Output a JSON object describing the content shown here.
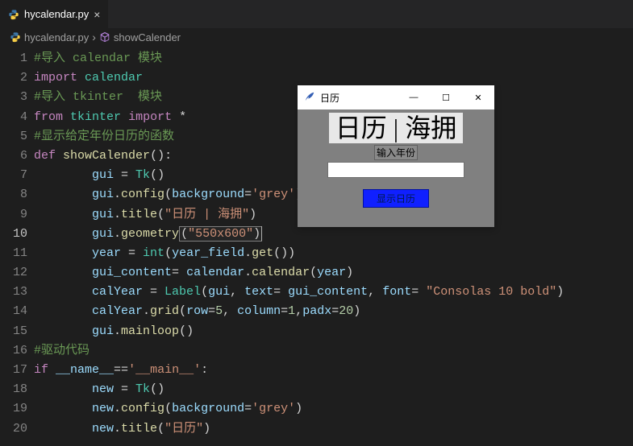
{
  "tab": {
    "filename": "hycalendar.py"
  },
  "breadcrumb": {
    "file": "hycalendar.py",
    "symbol": "showCalender"
  },
  "lines": [
    {
      "n": 1,
      "kind": "comment",
      "text": "#导入 calendar 模块"
    },
    {
      "n": 2,
      "kind": "import",
      "kw": "import",
      "mod": "calendar"
    },
    {
      "n": 3,
      "kind": "comment",
      "text": "#导入 tkinter  模块"
    },
    {
      "n": 4,
      "kind": "from",
      "kw1": "from",
      "mod": "tkinter",
      "kw2": "import",
      "star": "*"
    },
    {
      "n": 5,
      "kind": "comment",
      "text": "#显示给定年份日历的函数"
    },
    {
      "n": 6,
      "kind": "def",
      "kw": "def",
      "name": "showCalender",
      "sig": "():"
    },
    {
      "n": 7,
      "kind": "assign",
      "indent": 2,
      "lhs": "gui",
      "rhs_call": "Tk",
      "rhs_args": ""
    },
    {
      "n": 8,
      "kind": "call",
      "indent": 2,
      "obj": "gui",
      "method": "config",
      "args_kv": [
        [
          "background",
          "'grey'"
        ]
      ]
    },
    {
      "n": 9,
      "kind": "call",
      "indent": 2,
      "obj": "gui",
      "method": "title",
      "args_str": "\"日历 | 海拥\""
    },
    {
      "n": 10,
      "kind": "call",
      "indent": 2,
      "obj": "gui",
      "method": "geometry",
      "args_str": "\"550x600\"",
      "highlight": true,
      "current": true
    },
    {
      "n": 11,
      "kind": "assign",
      "indent": 2,
      "lhs": "year",
      "rhs_raw": "int(year_field.get())"
    },
    {
      "n": 12,
      "kind": "assign2",
      "indent": 2,
      "lhs": "gui_content",
      "rhs_obj": "calendar",
      "rhs_method": "calendar",
      "rhs_args_var": "year"
    },
    {
      "n": 13,
      "kind": "assign3",
      "indent": 2,
      "lhs": "calYear",
      "rhs": "Label(gui, text= gui_content, font= \"Consolas 10 bold\")"
    },
    {
      "n": 14,
      "kind": "call2",
      "indent": 2,
      "obj": "calYear",
      "method": "grid",
      "args": "row=5, column=1,padx=20"
    },
    {
      "n": 15,
      "kind": "call",
      "indent": 2,
      "obj": "gui",
      "method": "mainloop",
      "args_str": "",
      "noargs": true
    },
    {
      "n": 16,
      "kind": "comment",
      "text": "#驱动代码"
    },
    {
      "n": 17,
      "kind": "ifmain",
      "kw": "if",
      "lhs": "__name__",
      "eq": "==",
      "rhs": "'__main__'",
      "colon": ":"
    },
    {
      "n": 18,
      "kind": "assign",
      "indent": 2,
      "lhs": "new",
      "rhs_call": "Tk",
      "rhs_args": ""
    },
    {
      "n": 19,
      "kind": "call",
      "indent": 2,
      "obj": "new",
      "method": "config",
      "args_kv": [
        [
          "background",
          "'grey'"
        ]
      ]
    },
    {
      "n": 20,
      "kind": "call",
      "indent": 2,
      "obj": "new",
      "method": "title",
      "args_str": "\"日历\""
    }
  ],
  "tkwin": {
    "title": "日历",
    "banner": "日历 | 海拥",
    "input_label": "输入年份",
    "button_label": "显示日历"
  }
}
